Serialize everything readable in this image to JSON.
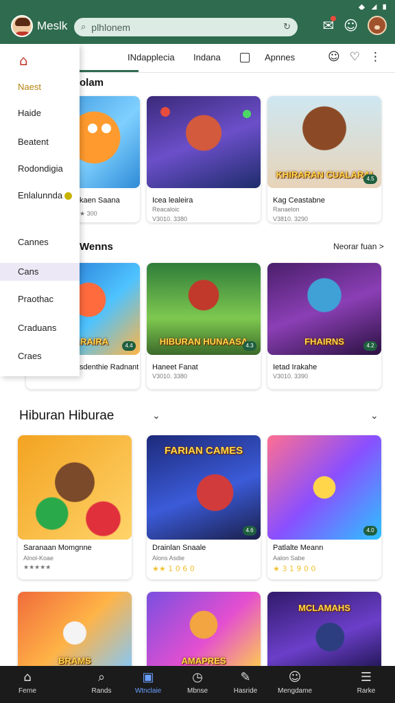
{
  "status_bar": {
    "wifi_icon": "wifi-icon",
    "signal_icon": "signal-icon",
    "battery_icon": "battery-icon"
  },
  "app_bar": {
    "app_name": "Meslk",
    "search": {
      "placeholder": "plhlonem"
    },
    "actions": [
      "notification-icon",
      "person-icon",
      "bear-avatar"
    ]
  },
  "tabs": {
    "items": [
      "INdapplecia",
      "Indana",
      "Apnnes"
    ],
    "active": 0
  },
  "drawer": {
    "items": [
      {
        "label": "Naest",
        "style": "gold"
      },
      {
        "label": "Haide"
      },
      {
        "label": "Beatent"
      },
      {
        "label": "Rodondigia"
      },
      {
        "label": "Enlalunnda"
      },
      {
        "label": "Cannes"
      },
      {
        "label": "Cans",
        "active": true
      },
      {
        "label": "Praothac"
      },
      {
        "label": "Craduans"
      },
      {
        "label": "Craes"
      }
    ]
  },
  "sections": [
    {
      "title": "olam",
      "see_all": "",
      "cards": [
        {
          "title": "kaen Saana",
          "subtitle": "",
          "rating_text": "★ 300",
          "image_text": ""
        },
        {
          "title": "Icea lealeira",
          "subtitle": "Reacaloic",
          "rating_text": "V3010. 3380",
          "image_text": ""
        },
        {
          "title": "Kag Ceastabne",
          "subtitle": "Ranaelon",
          "rating_text": "V3810. 3290",
          "image_text": "KHIRARAN CUALARAI"
        }
      ]
    },
    {
      "title": "Wenns",
      "see_all": "Neorar fuan >",
      "cards": [
        {
          "title": "sdenthie Radnant",
          "subtitle": "",
          "rating_text": "",
          "image_text": "HIMARAIRA"
        },
        {
          "title": "Haneet Fanat",
          "subtitle": "",
          "rating_text": "V3010. 3380",
          "image_text": "HIBURAN HUNAASA"
        },
        {
          "title": "Ietad Irakahe",
          "subtitle": "",
          "rating_text": "V3010. 3390",
          "image_text": "FHAIRNS"
        }
      ]
    },
    {
      "title": "Hiburan Hiburae",
      "see_all": "",
      "cards": [
        {
          "title": "Saranaan Momgnne",
          "subtitle": "Alnol-Koae",
          "rating_text": "★★★★★",
          "image_text": ""
        },
        {
          "title": "Drainlan Snaale",
          "subtitle": "Alons Asdie",
          "rating_text": "★★ 1 0 6 0",
          "image_text": "FARIAN CAMES"
        },
        {
          "title": "Patlalte Meann",
          "subtitle": "Aalon Sabe",
          "rating_text": "★ 3 1 9 0 0",
          "image_text": ""
        }
      ]
    },
    {
      "cards": [
        {
          "title": "",
          "image_text": "BRAMS"
        },
        {
          "title": "",
          "image_text": "AMAPRES"
        },
        {
          "title": "",
          "image_text": "MCLAMAHS"
        }
      ]
    }
  ],
  "bottom_nav": [
    {
      "label": "Ferne",
      "icon": "home-icon"
    },
    {
      "label": "Rands",
      "icon": "search-icon"
    },
    {
      "label": "Wtnclaie",
      "icon": "games-icon",
      "active": true
    },
    {
      "label": "Mbnse",
      "icon": "clock-icon"
    },
    {
      "label": "Hasride",
      "icon": "edit-icon"
    },
    {
      "label": "Mengdame",
      "icon": "profile-icon"
    },
    {
      "label": "Rarke",
      "icon": "list-icon"
    }
  ]
}
